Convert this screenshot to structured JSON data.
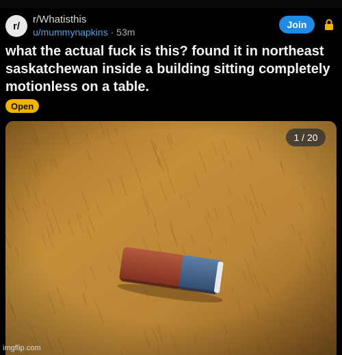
{
  "post": {
    "subreddit": "r/Whatisthis",
    "subreddit_icon_text": "r/",
    "author": "u/mummynapkins",
    "separator": "·",
    "age": "53m",
    "title": "what the actual fuck is this? found it in northeast saskatchewan inside a building sitting completely motionless on a table.",
    "flair": "Open"
  },
  "actions": {
    "join_label": "Join"
  },
  "media": {
    "counter": "1 / 20",
    "subject": "eraser on a wooden table"
  },
  "watermark": "imgflip.com",
  "colors": {
    "background": "#000000",
    "join_button": "#1f8be6",
    "flair": "#f0b400",
    "username": "#4fa3e0",
    "lock": "#f0b400"
  },
  "icons": [
    "subreddit-icon",
    "lock-icon"
  ]
}
